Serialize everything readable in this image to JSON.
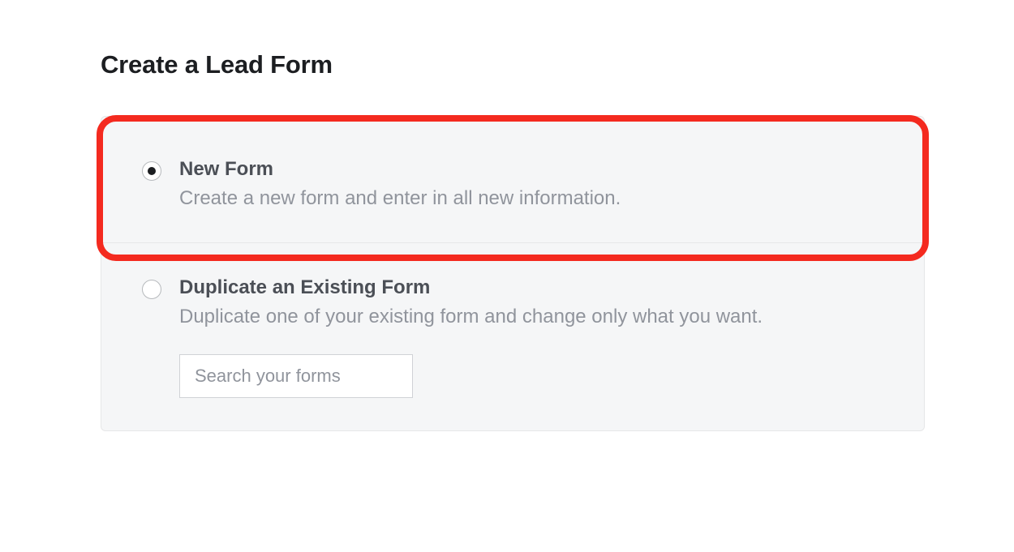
{
  "title": "Create a Lead Form",
  "options": {
    "new": {
      "label": "New Form",
      "desc": "Create a new form and enter in all new information."
    },
    "dup": {
      "label": "Duplicate an Existing Form",
      "desc": "Duplicate one of your existing form and change only what you want."
    }
  },
  "search": {
    "placeholder": "Search your forms"
  }
}
